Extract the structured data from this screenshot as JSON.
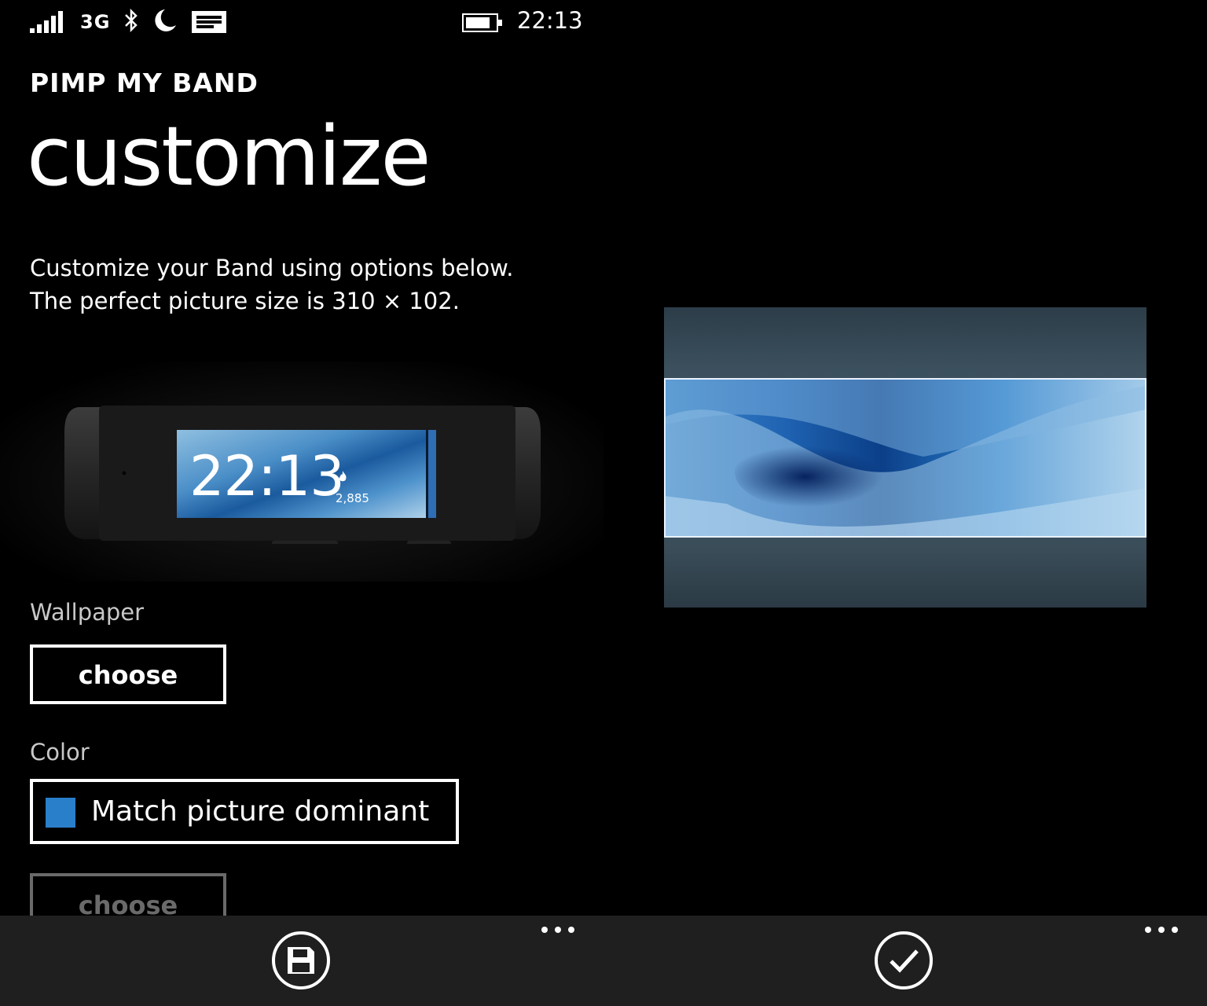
{
  "status": {
    "network": "3G",
    "time": "22:13",
    "icons": [
      "signal-icon",
      "bluetooth-icon",
      "moon-icon",
      "message-icon",
      "battery-icon"
    ]
  },
  "app": {
    "title": "PIMP MY BAND",
    "page_title": "customize"
  },
  "description": {
    "line1": "Customize your Band using options below.",
    "line2": "The perfect picture size is 310 × 102."
  },
  "band_preview": {
    "time": "22:13",
    "steps": "2,885",
    "accent_color": "#2f6db5"
  },
  "wallpaper": {
    "label": "Wallpaper",
    "button": "choose"
  },
  "color": {
    "label": "Color",
    "selected": "Match picture dominant",
    "swatch": "#2a7fcb"
  },
  "extra": {
    "button": "choose"
  },
  "appbar": {
    "left_icon": "save-icon",
    "right_icon": "check-icon",
    "more_icon": "ellipsis-icon"
  },
  "colors": {
    "background": "#000000",
    "appbar": "#1f1f1f",
    "accent": "#2a7fcb"
  }
}
